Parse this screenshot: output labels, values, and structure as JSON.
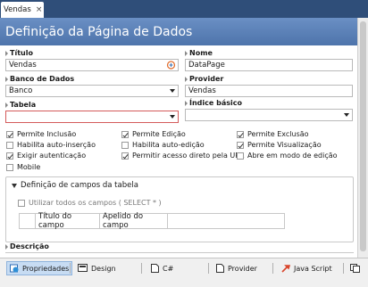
{
  "tab": {
    "label": "Vendas",
    "close": "×"
  },
  "header": {
    "title": "Definição da Página de Dados"
  },
  "form": {
    "titulo": {
      "label": "Título",
      "value": "Vendas"
    },
    "nome": {
      "label": "Nome",
      "value": "DataPage"
    },
    "banco": {
      "label": "Banco de Dados",
      "value": "Banco"
    },
    "provider": {
      "label": "Provider",
      "value": "Vendas"
    },
    "tabela": {
      "label": "Tabela",
      "value": ""
    },
    "indice": {
      "label": "Índice básico",
      "value": ""
    }
  },
  "options": [
    {
      "label": "Permite Inclusão",
      "checked": true
    },
    {
      "label": "Permite Edição",
      "checked": true
    },
    {
      "label": "Permite Exclusão",
      "checked": true
    },
    {
      "label": "Habilita auto-inserção",
      "checked": false
    },
    {
      "label": "Habilita auto-edição",
      "checked": false
    },
    {
      "label": "Permite Visualização",
      "checked": true
    },
    {
      "label": "Exigir autenticação",
      "checked": true
    },
    {
      "label": "Permitir acesso direto pela URL",
      "checked": true
    },
    {
      "label": "Abre em modo de edição",
      "checked": false
    },
    {
      "label": "Mobile",
      "checked": false
    }
  ],
  "group": {
    "title": "Definição de campos da tabela",
    "use_all": "Utilizar todos os campos ( SELECT * )",
    "columns": [
      "Título do campo",
      "Apelido do campo"
    ]
  },
  "descricao": {
    "label": "Descrição"
  },
  "bottom_tabs": [
    "Propriedades",
    "Design",
    "C#",
    "Provider",
    "Java Script"
  ],
  "colors": {
    "header": "#5a7fb6",
    "tabbar": "#2f4e79",
    "active_tab": "#c7dcf3",
    "invalid_border": "#d45a5a"
  }
}
